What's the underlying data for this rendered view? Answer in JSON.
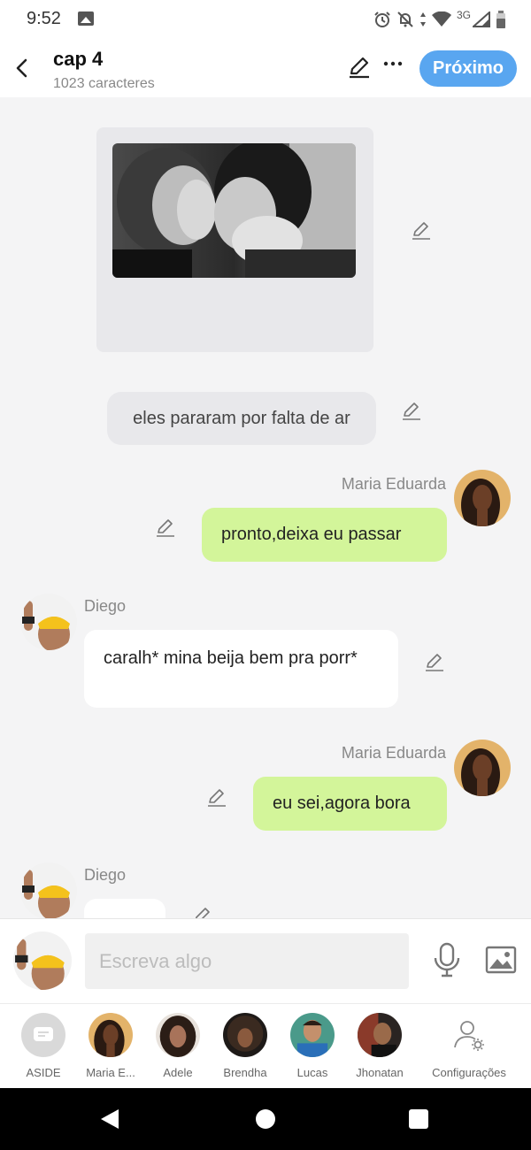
{
  "status_bar": {
    "time": "9:52",
    "network": "3G"
  },
  "header": {
    "title": "cap 4",
    "subtitle": "1023 caracteres",
    "next_label": "Próximo"
  },
  "messages": {
    "narration": "eles pararam por falta de ar",
    "m1_name": "Maria Eduarda",
    "m1_text": "pronto,deixa eu passar",
    "m2_name": "Diego",
    "m2_text": "caralh* mina beija bem pra porr*",
    "m3_name": "Maria Eduarda",
    "m3_text": "eu sei,agora bora",
    "m4_name": "Diego"
  },
  "composer": {
    "placeholder": "Escreva algo"
  },
  "characters": [
    {
      "label": "ASIDE"
    },
    {
      "label": "Maria E..."
    },
    {
      "label": "Adele"
    },
    {
      "label": "Brendha"
    },
    {
      "label": "Lucas"
    },
    {
      "label": "Jhonatan"
    },
    {
      "label": "Configurações"
    }
  ],
  "colors": {
    "accent": "#59a6f0",
    "own_bubble": "#d3f59a",
    "narration_bubble": "#e8e8eb",
    "background": "#f4f4f5"
  }
}
